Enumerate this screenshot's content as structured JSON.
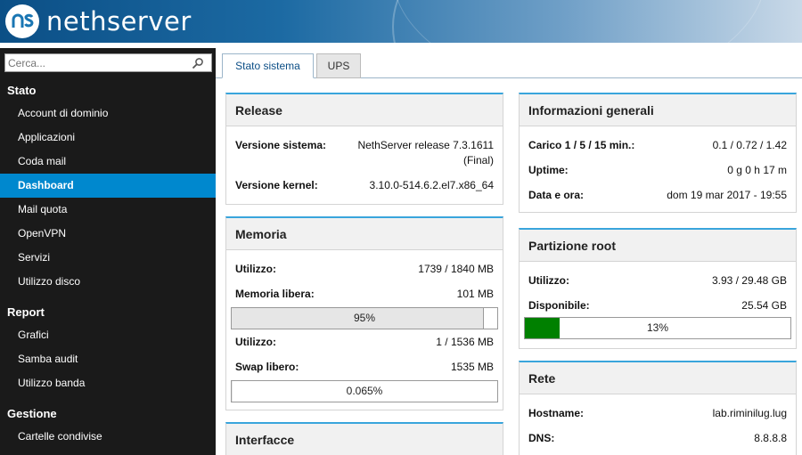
{
  "header": {
    "brand": "nethserver"
  },
  "sidebar": {
    "search_placeholder": "Cerca...",
    "sections": [
      {
        "title": "Stato",
        "items": [
          "Account di dominio",
          "Applicazioni",
          "Coda mail",
          "Dashboard",
          "Mail quota",
          "OpenVPN",
          "Servizi",
          "Utilizzo disco"
        ]
      },
      {
        "title": "Report",
        "items": [
          "Grafici",
          "Samba audit",
          "Utilizzo banda"
        ]
      },
      {
        "title": "Gestione",
        "items": [
          "Cartelle condivise"
        ]
      }
    ],
    "active_item": "Dashboard"
  },
  "tabs": [
    {
      "label": "Stato sistema",
      "active": true
    },
    {
      "label": "UPS",
      "active": false
    }
  ],
  "panels": {
    "release": {
      "title": "Release",
      "system_version_label": "Versione sistema:",
      "system_version_value_line1": "NethServer release 7.3.1611",
      "system_version_value_line2": "(Final)",
      "kernel_label": "Versione kernel:",
      "kernel_value": "3.10.0-514.6.2.el7.x86_64"
    },
    "memory": {
      "title": "Memoria",
      "mem_usage_label": "Utilizzo:",
      "mem_usage_value": "1739 / 1840 MB",
      "mem_free_label": "Memoria libera:",
      "mem_free_value": "101 MB",
      "mem_bar_label": "95%",
      "mem_bar_fraction": 0.95,
      "swap_usage_label": "Utilizzo:",
      "swap_usage_value": "1 / 1536 MB",
      "swap_free_label": "Swap libero:",
      "swap_free_value": "1535 MB",
      "swap_bar_label": "0.065%",
      "swap_bar_fraction": 0.00065
    },
    "interfaces": {
      "title": "Interfacce"
    },
    "general": {
      "title": "Informazioni generali",
      "load_label_prefix": "Carico ",
      "load_label_bold": "1 / 5 / 15 min.:",
      "load_value": "0.1 / 0.72 / 1.42",
      "uptime_label": "Uptime:",
      "uptime_value": "0 g 0 h 17 m",
      "datetime_label": "Data e ora:",
      "datetime_value": "dom 19 mar 2017 - 19:55"
    },
    "root_partition": {
      "title": "Partizione root",
      "usage_label": "Utilizzo:",
      "usage_value": "3.93 / 29.48 GB",
      "available_label": "Disponibile:",
      "available_value": "25.54 GB",
      "bar_label": "13%",
      "bar_fraction": 0.13
    },
    "network": {
      "title": "Rete",
      "hostname_label": "Hostname:",
      "hostname_value": "lab.riminilug.lug",
      "dns_label": "DNS:",
      "dns_value": "8.8.8.8"
    }
  },
  "colors": {
    "accent": "#0088ce",
    "panel_top": "#39a5dc",
    "mem_bar": "#e6e6e6",
    "disk_bar": "#008000"
  }
}
